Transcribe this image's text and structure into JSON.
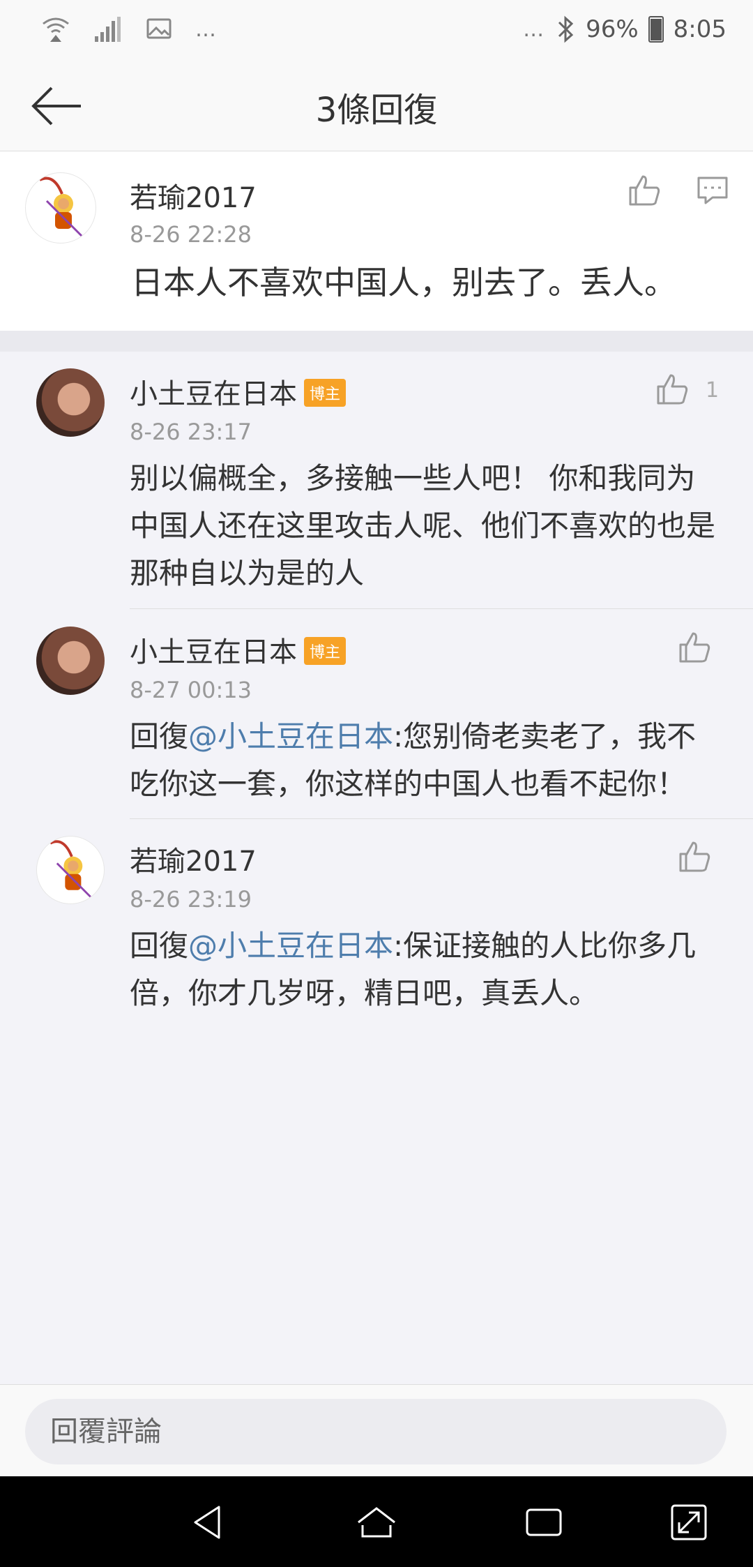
{
  "status_bar": {
    "dots_left": "…",
    "dots_right": "…",
    "battery": "96%",
    "time": "8:05",
    "icons": [
      "wifi-icon",
      "signal-icon",
      "image-icon",
      "bluetooth-icon",
      "battery-icon"
    ]
  },
  "nav": {
    "title": "3條回復",
    "back_icon": "arrow-left-icon"
  },
  "main_comment": {
    "author": "若瑜2017",
    "time": "8-26 22:28",
    "text": "日本人不喜欢中国人，别去了。丢人。"
  },
  "replies": [
    {
      "author": "小土豆在日本",
      "badge": "博主",
      "time": "8-26 23:17",
      "likes": "1",
      "line1": "别以偏概全，多接触一些人吧！ 你和我同为",
      "line2": "中国人还在这里攻击人呢、他们不喜欢的也是",
      "line3": "那种自以为是的人"
    },
    {
      "author": "小土豆在日本",
      "badge": "博主",
      "time": "8-27 00:13",
      "prefix": "回復",
      "mention": "@小土豆在日本",
      "line1_rest": ":您别倚老卖老了，我不",
      "line2": "吃你这一套，你这样的中国人也看不起你！"
    },
    {
      "author": "若瑜2017",
      "time": "8-26 23:19",
      "prefix": "回復",
      "mention": "@小土豆在日本",
      "line1_rest": ":保证接触的人比你多几",
      "line2": "倍，你才几岁呀，精日吧，真丢人。"
    }
  ],
  "reply_input": {
    "placeholder": "回覆評論"
  },
  "colors": {
    "link": "#4e7dac",
    "badge": "#f7a226",
    "time": "#999999"
  }
}
